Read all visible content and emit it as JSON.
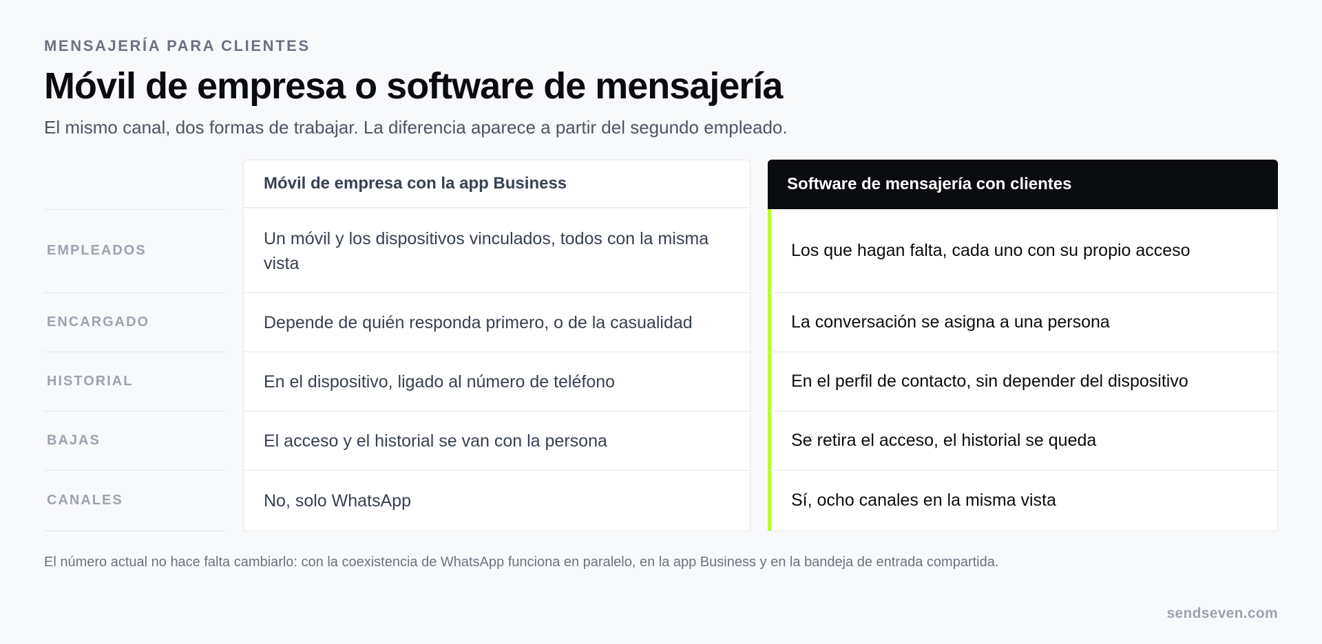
{
  "header": {
    "eyebrow": "MENSAJERÍA PARA CLIENTES",
    "title": "Móvil de empresa o software de mensajería",
    "subtitle": "El mismo canal, dos formas de trabajar. La diferencia aparece a partir del segundo empleado."
  },
  "comparison": {
    "column_a": "Móvil de empresa con la app Business",
    "column_b": "Software de mensajería con clientes",
    "rows": [
      {
        "label": "EMPLEADOS",
        "a": "Un móvil y los dispositivos vinculados, todos con la misma vista",
        "b": "Los que hagan falta, cada uno con su propio acceso"
      },
      {
        "label": "ENCARGADO",
        "a": "Depende de quién responda primero, o de la casualidad",
        "b": "La conversación se asigna a una persona"
      },
      {
        "label": "HISTORIAL",
        "a": "En el dispositivo, ligado al número de teléfono",
        "b": "En el perfil de contacto, sin depender del dispositivo"
      },
      {
        "label": "BAJAS",
        "a": "El acceso y el historial se van con la persona",
        "b": "Se retira el acceso, el historial se queda"
      },
      {
        "label": "CANALES",
        "a": "No, solo WhatsApp",
        "b": "Sí, ocho canales en la misma vista"
      }
    ]
  },
  "footer": {
    "note": "El número actual no hace falta cambiarlo: con la coexistencia de WhatsApp funciona en paralelo, en la app Business y en la bandeja de entrada compartida.",
    "brand": "sendseven.com"
  },
  "colors": {
    "accent": "#b5ff2e",
    "dark_header": "#0b0c0f",
    "background": "#f8f9fb"
  }
}
